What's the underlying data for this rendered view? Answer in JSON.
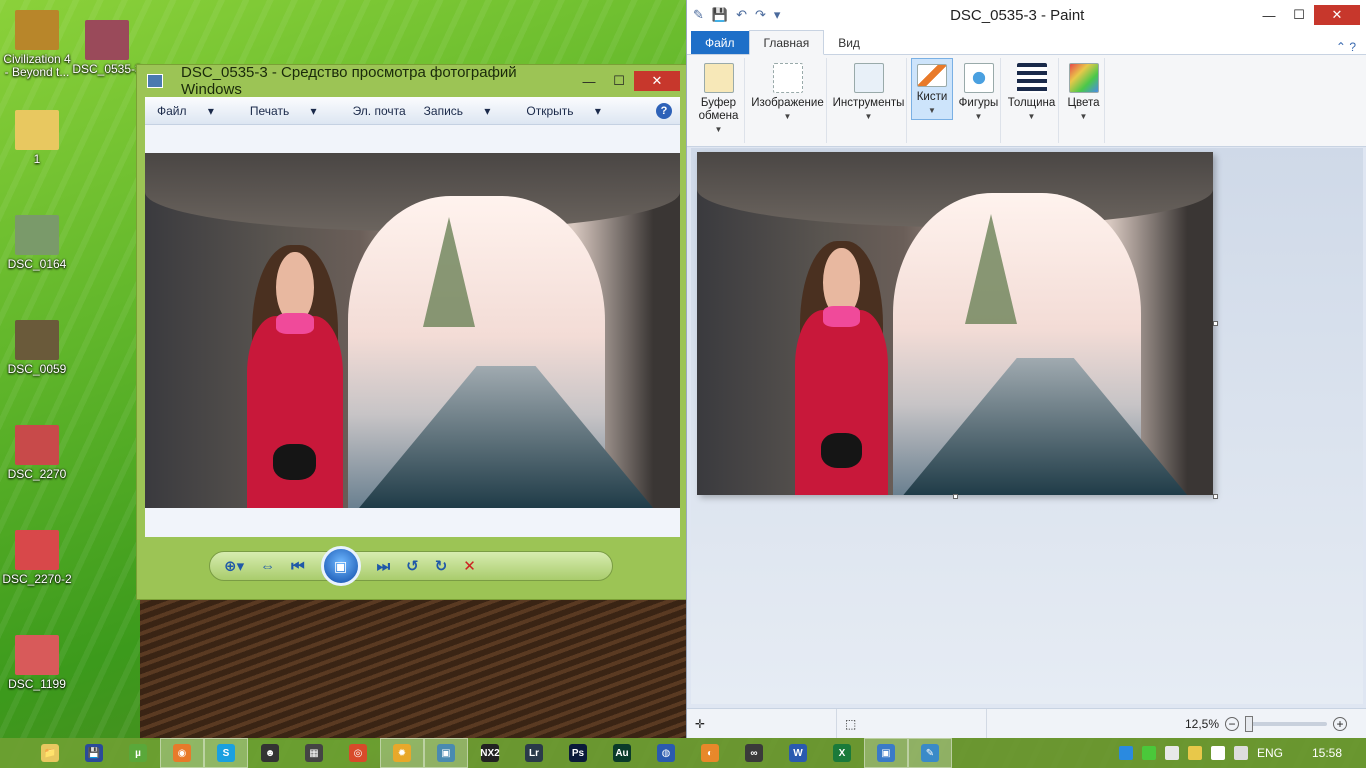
{
  "desktop": {
    "icons": [
      {
        "label": "Civilization 4 - Beyond t...",
        "color": "#b8862a"
      },
      {
        "label": "DSC_0535-3",
        "color": "#9a4a5a"
      },
      {
        "label": "1",
        "color": "#e8c860"
      },
      {
        "label": "DSC_0164",
        "color": "#7a9a6a"
      },
      {
        "label": "DSC_0059",
        "color": "#6a5a3a"
      },
      {
        "label": "DSC_2270",
        "color": "#c84a4a"
      },
      {
        "label": "DSC_2270-2",
        "color": "#d8484a"
      },
      {
        "label": "DSC_1199",
        "color": "#d85a5a"
      }
    ]
  },
  "photo_viewer": {
    "title": "DSC_0535-3 - Средство просмотра фотографий Windows",
    "menu": {
      "file": "Файл",
      "print": "Печать",
      "email": "Эл. почта",
      "burn": "Запись",
      "open": "Открыть",
      "help": "?"
    },
    "window_buttons": {
      "minimize": "—",
      "maximize": "☐",
      "close": "✕"
    },
    "toolbar": {
      "zoom": "⊕▾",
      "fit": "⇔",
      "prev": "⏮",
      "slideshow": "▣",
      "next": "⏭",
      "rotate_ccw": "↺",
      "rotate_cw": "↻",
      "delete": "✕"
    }
  },
  "paint": {
    "title": "DSC_0535-3 - Paint",
    "quick_access": {
      "app": "✎",
      "save": "💾",
      "undo": "↶",
      "redo": "↷",
      "more": "▾"
    },
    "window_buttons": {
      "minimize": "—",
      "maximize": "☐",
      "close": "✕"
    },
    "tabs": {
      "file": "Файл",
      "home": "Главная",
      "view": "Вид",
      "collapse": "⌃",
      "help": "?"
    },
    "ribbon": {
      "clipboard": "Буфер обмена",
      "image": "Изображение",
      "tools": "Инструменты",
      "brushes": "Кисти",
      "shapes": "Фигуры",
      "size": "Толщина",
      "colors": "Цвета"
    },
    "status": {
      "zoom": "12,5%",
      "zoom_out": "−",
      "zoom_in": "+",
      "position_icon": "✛",
      "selection_icon": "⬚"
    }
  },
  "taskbar": {
    "apps": [
      {
        "name": "explorer",
        "glyph": "📁",
        "color": "#e8c860",
        "active": false
      },
      {
        "name": "save",
        "glyph": "💾",
        "color": "#2a4a9a",
        "active": false
      },
      {
        "name": "torrent",
        "glyph": "µ",
        "color": "#5aa83a",
        "active": false
      },
      {
        "name": "firefox",
        "glyph": "◉",
        "color": "#e87a2a",
        "active": true
      },
      {
        "name": "skype",
        "glyph": "S",
        "color": "#1aa0e0",
        "active": true
      },
      {
        "name": "alien",
        "glyph": "☻",
        "color": "#333",
        "active": false
      },
      {
        "name": "clapper",
        "glyph": "▦",
        "color": "#444",
        "active": false
      },
      {
        "name": "chrome",
        "glyph": "◎",
        "color": "#d84a2a",
        "active": false
      },
      {
        "name": "sun",
        "glyph": "✹",
        "color": "#e8a82a",
        "active": true
      },
      {
        "name": "photo",
        "glyph": "▣",
        "color": "#4a8ab0",
        "active": true
      },
      {
        "name": "nx2",
        "glyph": "NX2",
        "color": "#222",
        "active": false
      },
      {
        "name": "lightroom",
        "glyph": "Lr",
        "color": "#2a3a4a",
        "active": false
      },
      {
        "name": "photoshop",
        "glyph": "Ps",
        "color": "#0a1a3a",
        "active": false
      },
      {
        "name": "audition",
        "glyph": "Au",
        "color": "#0a3a2a",
        "active": false
      },
      {
        "name": "globe",
        "glyph": "◍",
        "color": "#2a5ab0",
        "active": false
      },
      {
        "name": "orange",
        "glyph": "◐",
        "color": "#e8882a",
        "active": false
      },
      {
        "name": "binoculars",
        "glyph": "∞",
        "color": "#3a3a3a",
        "active": false
      },
      {
        "name": "word",
        "glyph": "W",
        "color": "#2a5ab0",
        "active": false
      },
      {
        "name": "excel",
        "glyph": "X",
        "color": "#1a7a3a",
        "active": false
      },
      {
        "name": "photo-viewer",
        "glyph": "▣",
        "color": "#3a7ac8",
        "active": true
      },
      {
        "name": "paint",
        "glyph": "✎",
        "color": "#3a8ac8",
        "active": true
      }
    ],
    "tray": {
      "lang": "ENG",
      "time": "15:58"
    }
  }
}
